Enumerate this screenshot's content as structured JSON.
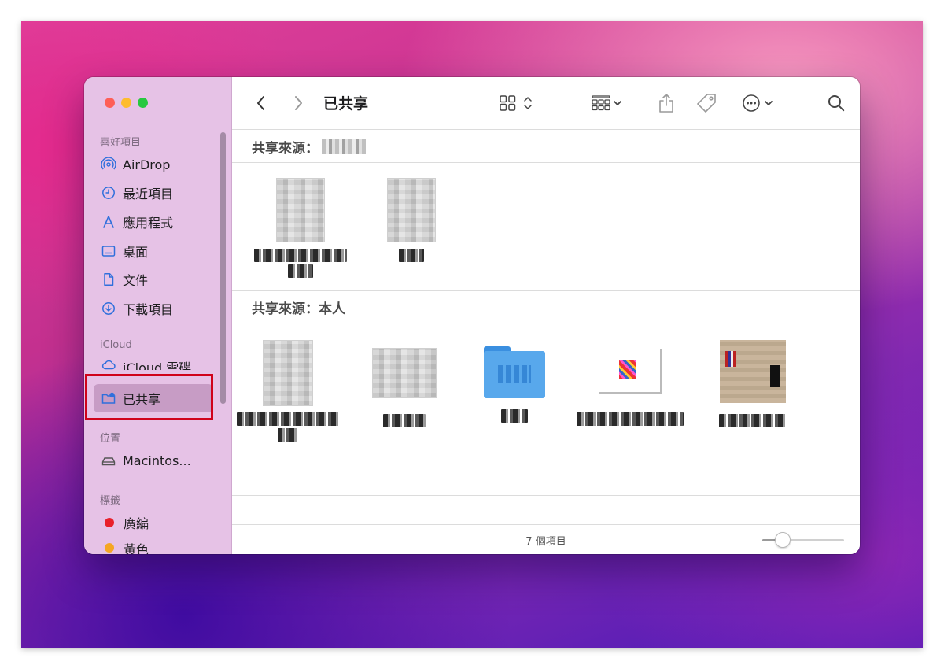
{
  "window": {
    "title": "已共享",
    "status": "7 個項目"
  },
  "sidebar": {
    "sections": {
      "favorites": "喜好項目",
      "icloud": "iCloud",
      "locations": "位置",
      "tags": "標籤"
    },
    "favorites": [
      {
        "label": "AirDrop",
        "icon": "airdrop-icon"
      },
      {
        "label": "最近項目",
        "icon": "clock-icon"
      },
      {
        "label": "應用程式",
        "icon": "applications-icon"
      },
      {
        "label": "桌面",
        "icon": "desktop-icon"
      },
      {
        "label": "文件",
        "icon": "document-icon"
      },
      {
        "label": "下載項目",
        "icon": "download-icon"
      }
    ],
    "icloud": [
      {
        "label": "iCloud 雲碟",
        "icon": "cloud-icon"
      },
      {
        "label": "已共享",
        "icon": "shared-folder-icon",
        "selected": true
      }
    ],
    "locations": [
      {
        "label": "Macintos...",
        "icon": "disk-icon"
      }
    ],
    "tags": [
      {
        "label": "廣編",
        "color": "#e8202a"
      },
      {
        "label": "黃色",
        "color": "#f5a623"
      }
    ]
  },
  "toolbar": {
    "back": "back-icon",
    "forward": "forward-icon",
    "view_mode": "grid-view-icon",
    "group_by": "group-icon",
    "share": "share-icon",
    "tag": "tag-icon",
    "more": "more-icon",
    "search": "search-icon"
  },
  "groups": [
    {
      "label": "共享來源："
    },
    {
      "label": "共享來源：本人"
    }
  ],
  "highlight_color": "#d0021b"
}
